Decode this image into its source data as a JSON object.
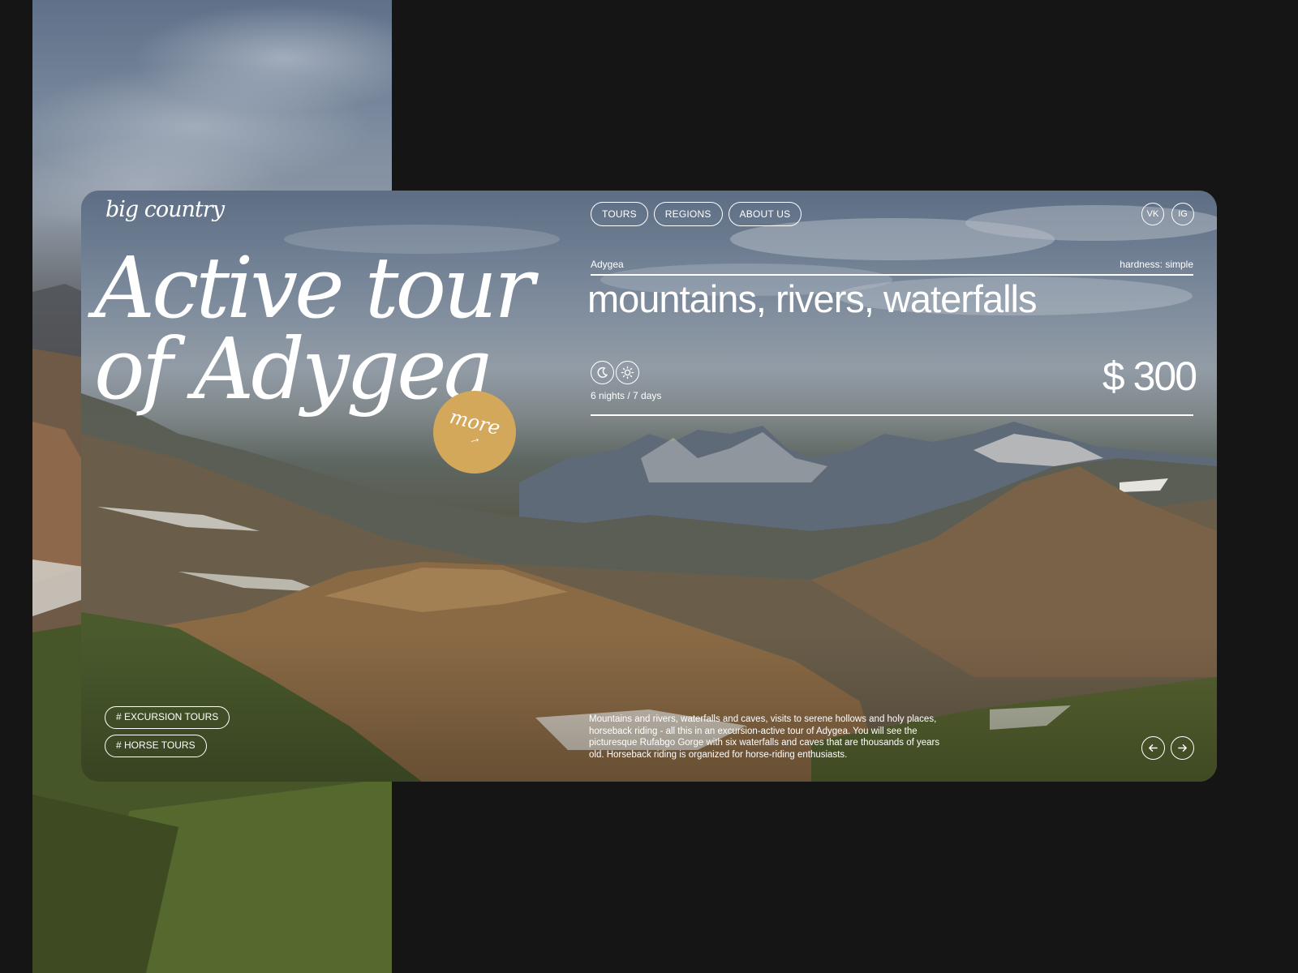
{
  "brand": {
    "logo_text": "big country"
  },
  "nav": {
    "items": [
      {
        "label": "TOURS"
      },
      {
        "label": "REGIONS"
      },
      {
        "label": "ABOUT US"
      }
    ]
  },
  "social": {
    "vk": "VK",
    "ig": "IG"
  },
  "hero": {
    "title_line1": "Active tour",
    "title_line2": "of Adygea",
    "more_label": "more",
    "more_arrow": "→"
  },
  "tour": {
    "region": "Adygea",
    "hardness": "hardness: simple",
    "tagline": "mountains, rivers, waterfalls",
    "duration": "6 nights / 7 days",
    "price": "$ 300",
    "icons": [
      "moon-icon",
      "sun-icon"
    ]
  },
  "tags": [
    {
      "label": "# EXCURSION TOURS"
    },
    {
      "label": "# HORSE TOURS"
    }
  ],
  "description": "Mountains and rivers, waterfalls and caves, visits to serene hollows and holy places, horseback riding - all this in an excursion-active tour of Adygea. You will see the picturesque Rufabgo Gorge with six waterfalls and caves that are thousands of years old. Horseback riding is organized for horse-riding enthusiasts.",
  "colors": {
    "page_bg": "#151515",
    "accent": "#d4a85a",
    "text": "#ffffff"
  }
}
